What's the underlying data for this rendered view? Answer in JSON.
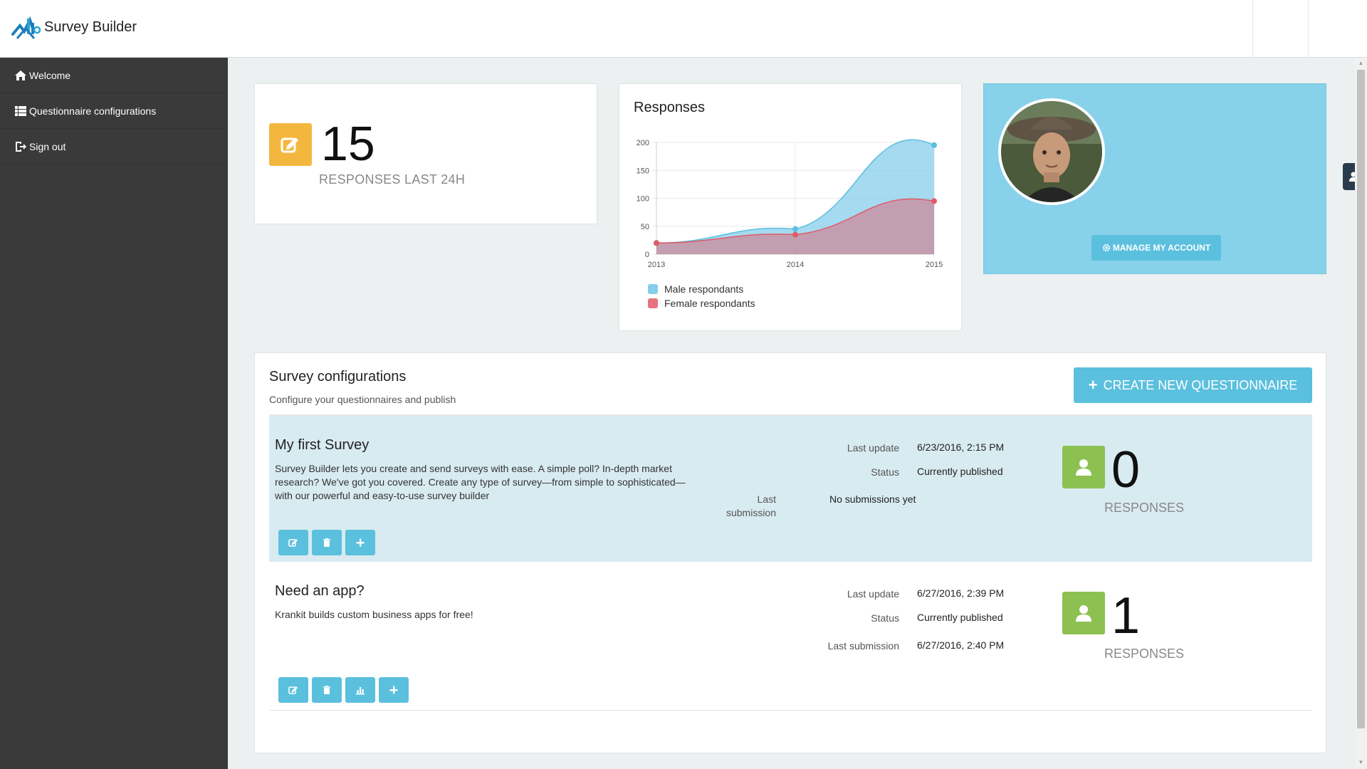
{
  "app": {
    "title": "Survey Builder"
  },
  "sidebar": {
    "items": [
      {
        "label": "Welcome",
        "icon": "home-icon"
      },
      {
        "label": "Questionnaire configurations",
        "icon": "grid-list-icon"
      },
      {
        "label": "Sign out",
        "icon": "sign-out-icon"
      }
    ]
  },
  "stat": {
    "value": "15",
    "label": "RESPONSES LAST 24H"
  },
  "chart": {
    "title": "Responses"
  },
  "chart_data": {
    "type": "area",
    "title": "Responses",
    "x": [
      "2013",
      "2014",
      "2015"
    ],
    "series": [
      {
        "name": "Male respondants",
        "values": [
          20,
          45,
          195
        ],
        "color": "#87ceeb"
      },
      {
        "name": "Female respondants",
        "values": [
          20,
          35,
          95
        ],
        "color": "#e6727f"
      }
    ],
    "y_ticks": [
      "0",
      "50",
      "100",
      "150",
      "200"
    ],
    "ylim": [
      0,
      200
    ],
    "grid": true,
    "legend": "bottom-left"
  },
  "profile": {
    "manage_label": "MANAGE MY ACCOUNT"
  },
  "surveys": {
    "title": "Survey configurations",
    "subtitle": "Configure your questionnaires and publish",
    "create_label": "CREATE NEW QUESTIONNAIRE",
    "items": [
      {
        "name": "My first Survey",
        "description": "Survey Builder lets you create and send surveys with ease. A simple poll? In-depth market research? We've got you covered. Create any type of survey—from simple to sophisticated—with our powerful and easy-to-use survey builder",
        "last_update_label": "Last update",
        "last_update": "6/23/2016, 2:15 PM",
        "status_label": "Status",
        "status": "Currently published",
        "last_submission_label": "Last submission",
        "last_submission": "No submissions yet",
        "responses": "0",
        "responses_label": "RESPONSES"
      },
      {
        "name": "Need an app?",
        "description": "Krankit builds custom business apps for free!",
        "last_update_label": "Last update",
        "last_update": "6/27/2016, 2:39 PM",
        "status_label": "Status",
        "status": "Currently published",
        "last_submission_label": "Last submission",
        "last_submission": "6/27/2016, 2:40 PM",
        "responses": "1",
        "responses_label": "RESPONSES"
      }
    ]
  },
  "colors": {
    "sidebar": "#3a3a3a",
    "accent": "#5bc0de",
    "stat_icon": "#f4b73d",
    "responses_icon": "#8cc152",
    "profile_bg": "#87d1ea"
  }
}
